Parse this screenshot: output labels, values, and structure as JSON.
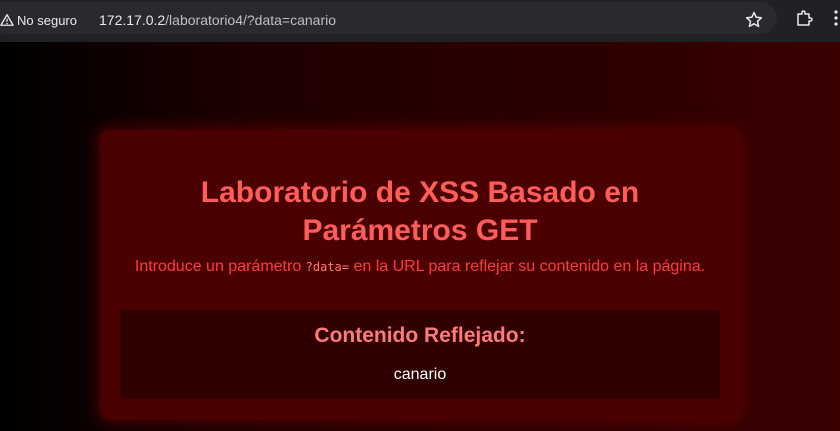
{
  "browser": {
    "security_label": "No seguro",
    "url_host": "172.17.0.2",
    "url_path": "/laboratorio4/?data=canario",
    "icons": [
      "warning-icon",
      "star-icon",
      "extensions-icon",
      "more-icon"
    ]
  },
  "page": {
    "title_line1": "Laboratorio de XSS Basado en",
    "title_line2": "Parámetros GET",
    "desc_before": "Introduce un parámetro ",
    "desc_code": "?data=",
    "desc_after": " en la URL para reflejar su contenido en la página.",
    "reflect_heading": "Contenido Reflejado:",
    "reflect_value": "canario",
    "colors": {
      "accent": "#ff5c5c",
      "card_bg": "#4a0000",
      "panel_bg": "#300000"
    }
  }
}
